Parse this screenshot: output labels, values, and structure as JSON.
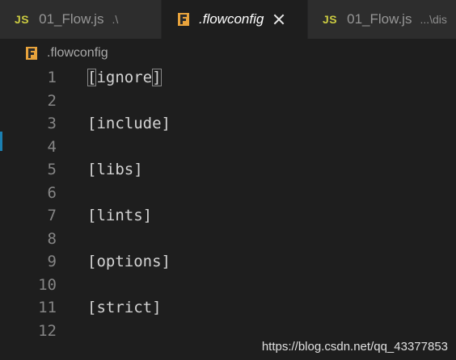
{
  "tabs": [
    {
      "badge": "JS",
      "name": "01_Flow.js",
      "desc": ".\\"
    },
    {
      "name": ".flowconfig"
    },
    {
      "badge": "JS",
      "name": "01_Flow.js",
      "desc": "...\\dis"
    }
  ],
  "breadcrumb": {
    "label": ".flowconfig",
    "icon": "flow-file-icon"
  },
  "lines": [
    {
      "num": "1",
      "text": "[ignore]"
    },
    {
      "num": "2",
      "text": ""
    },
    {
      "num": "3",
      "text": "[include]"
    },
    {
      "num": "4",
      "text": ""
    },
    {
      "num": "5",
      "text": "[libs]"
    },
    {
      "num": "6",
      "text": ""
    },
    {
      "num": "7",
      "text": "[lints]"
    },
    {
      "num": "8",
      "text": ""
    },
    {
      "num": "9",
      "text": "[options]"
    },
    {
      "num": "10",
      "text": ""
    },
    {
      "num": "11",
      "text": "[strict]"
    },
    {
      "num": "12",
      "text": ""
    }
  ],
  "line1": {
    "open": "[",
    "word": "ignore",
    "close": "]"
  },
  "watermark": "https://blog.csdn.net/qq_43377853",
  "colors": {
    "background": "#1e1e1e",
    "tabbar": "#252526",
    "js_badge": "#cbcb41",
    "accent": "#1b80b2"
  }
}
